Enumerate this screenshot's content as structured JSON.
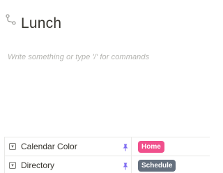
{
  "page": {
    "title": "Lunch",
    "title_icon": "git-branch-icon",
    "placeholder": "Write something or type '/' for commands"
  },
  "properties": [
    {
      "name": "Calendar Color",
      "type_icon": "select-property-icon",
      "pinned": true,
      "value": "Home",
      "value_color": "#f0508c"
    },
    {
      "name": "Directory",
      "type_icon": "select-property-icon",
      "pinned": true,
      "value": "Schedule",
      "value_color": "#65707e"
    }
  ],
  "colors": {
    "pin": "#7f6df2"
  }
}
